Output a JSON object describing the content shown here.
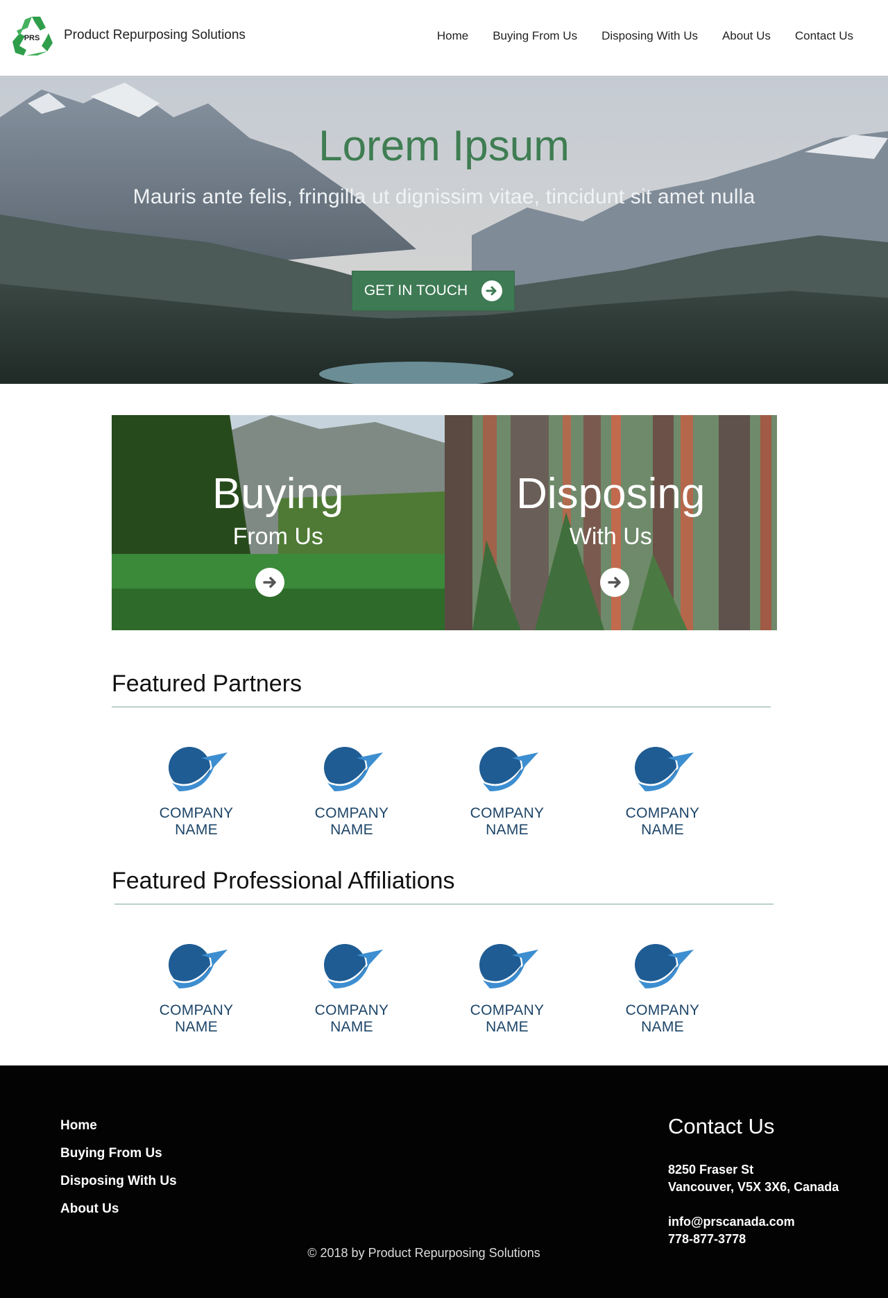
{
  "header": {
    "brand": "Product Repurposing Solutions",
    "logo_text": "PRS",
    "nav": [
      "Home",
      "Buying From Us",
      "Disposing With Us",
      "About Us",
      "Contact Us"
    ]
  },
  "hero": {
    "title": "Lorem Ipsum",
    "subtitle": "Mauris ante felis, fringilla ut dignissim vitae, tincidunt sit amet nulla",
    "cta_label": "GET IN TOUCH"
  },
  "cards": [
    {
      "title": "Buying",
      "subtitle": "From Us"
    },
    {
      "title": "Disposing",
      "subtitle": "With Us"
    }
  ],
  "partners": {
    "title": "Featured Partners",
    "items": [
      "COMPANY NAME",
      "COMPANY NAME",
      "COMPANY NAME",
      "COMPANY NAME"
    ]
  },
  "affiliations": {
    "title": "Featured Professional Affiliations",
    "items": [
      "COMPANY NAME",
      "COMPANY NAME",
      "COMPANY NAME",
      "COMPANY NAME"
    ]
  },
  "footer": {
    "nav": [
      "Home",
      "Buying From Us",
      "Disposing With Us",
      "About Us"
    ],
    "copyright": "© 2018  by Product Repurposing Solutions",
    "contact_title": "Contact Us",
    "address_line1": "8250 Fraser St",
    "address_line2": "Vancouver, V5X 3X6, Canada",
    "email": "info@prscanada.com",
    "phone": "778-877-3778"
  },
  "colors": {
    "brand_green": "#3e7a54",
    "footer_bg": "#030303",
    "company_blue": "#1d4568"
  }
}
